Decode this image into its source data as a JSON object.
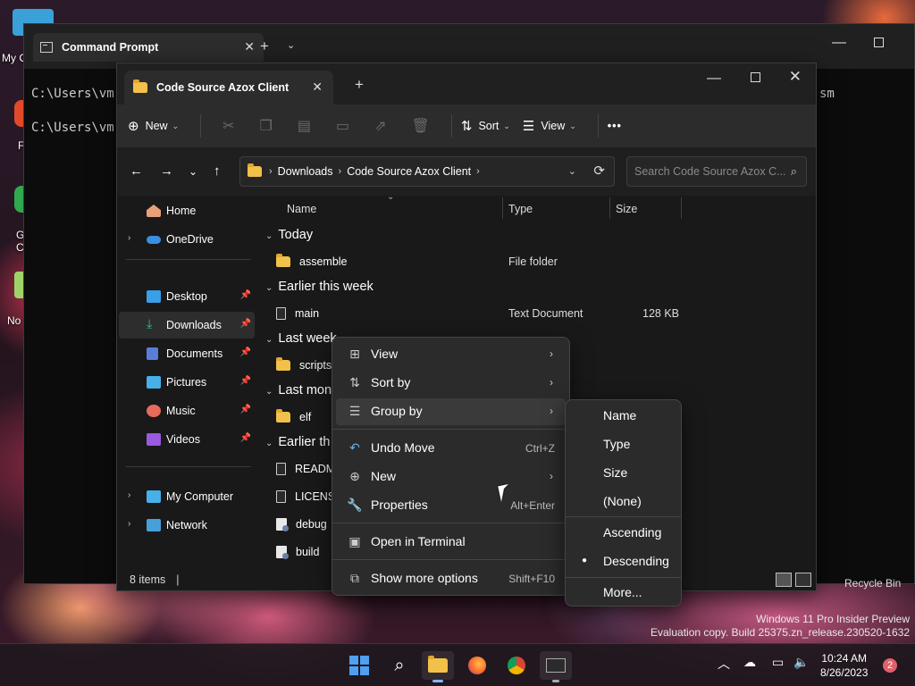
{
  "desktop": {
    "icons": [
      {
        "label": "My C"
      },
      {
        "label": "F"
      },
      {
        "label": "G"
      },
      {
        "label": "C"
      },
      {
        "label": "No"
      }
    ],
    "recycle_bin": "Recycle Bin",
    "watermark": {
      "line1": "Windows 11 Pro Insider Preview",
      "line2": "Evaluation copy. Build 25375.zn_release.230520-1632"
    }
  },
  "cmd": {
    "title": "Command Prompt",
    "lines": [
      "C:\\Users\\vm",
      "C:\\Users\\vm"
    ],
    "tail": "sm"
  },
  "explorer": {
    "tab_title": "Code Source Azox Client",
    "toolbar": {
      "new_label": "New",
      "sort_label": "Sort",
      "view_label": "View",
      "more_label": "•••"
    },
    "breadcrumb": [
      "Downloads",
      "Code Source Azox Client"
    ],
    "search_placeholder": "Search Code Source Azox C...",
    "sidebar": {
      "home": "Home",
      "onedrive": "OneDrive",
      "desktop": "Desktop",
      "downloads": "Downloads",
      "documents": "Documents",
      "pictures": "Pictures",
      "music": "Music",
      "videos": "Videos",
      "my_computer": "My Computer",
      "network": "Network"
    },
    "columns": {
      "name": "Name",
      "type": "Type",
      "size": "Size"
    },
    "groups": {
      "today": "Today",
      "earlier_this_week": "Earlier this week",
      "last_week": "Last week",
      "last_month": "Last mon",
      "earlier_this_year": "Earlier th"
    },
    "files": {
      "assemble": {
        "name": "assemble",
        "type": "File folder"
      },
      "main": {
        "name": "main",
        "type": "Text Document",
        "size": "128 KB"
      },
      "scripts": {
        "name": "scripts"
      },
      "elf": {
        "name": "elf"
      },
      "readme": {
        "name": "README"
      },
      "license": {
        "name": "LICENSE"
      },
      "debug": {
        "name": "debug"
      },
      "build": {
        "name": "build"
      }
    },
    "status": {
      "count": "8 items",
      "cursor": "|"
    }
  },
  "context_menu": {
    "view": "View",
    "sort_by": "Sort by",
    "group_by": "Group by",
    "undo_move": "Undo Move",
    "undo_key": "Ctrl+Z",
    "new": "New",
    "properties": "Properties",
    "properties_key": "Alt+Enter",
    "open_terminal": "Open in Terminal",
    "show_more": "Show more options",
    "show_more_key": "Shift+F10"
  },
  "group_by_menu": {
    "name": "Name",
    "type": "Type",
    "size": "Size",
    "none": "(None)",
    "ascending": "Ascending",
    "descending": "Descending",
    "more": "More..."
  },
  "taskbar": {
    "time": "10:24 AM",
    "date": "8/26/2023",
    "notification_count": "2"
  }
}
